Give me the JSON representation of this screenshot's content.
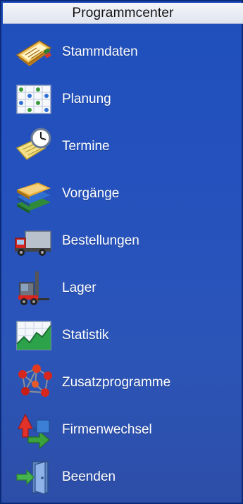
{
  "panel": {
    "title": "Programmcenter",
    "items": [
      {
        "label": "Stammdaten",
        "icon": "address-book-icon"
      },
      {
        "label": "Planung",
        "icon": "planning-board-icon"
      },
      {
        "label": "Termine",
        "icon": "clock-notepad-icon"
      },
      {
        "label": "Vorgänge",
        "icon": "book-stack-icon"
      },
      {
        "label": "Bestellungen",
        "icon": "delivery-truck-icon"
      },
      {
        "label": "Lager",
        "icon": "forklift-icon"
      },
      {
        "label": "Statistik",
        "icon": "chart-icon"
      },
      {
        "label": "Zusatzprogramme",
        "icon": "molecule-icon"
      },
      {
        "label": "Firmenwechsel",
        "icon": "switch-arrows-icon"
      },
      {
        "label": "Beenden",
        "icon": "exit-door-icon"
      }
    ]
  },
  "colors": {
    "panel_top": "#1f4fbc",
    "panel_bottom": "#2d4ea8",
    "header_bg": "#e6e9f2",
    "label_text": "#ffffff"
  }
}
